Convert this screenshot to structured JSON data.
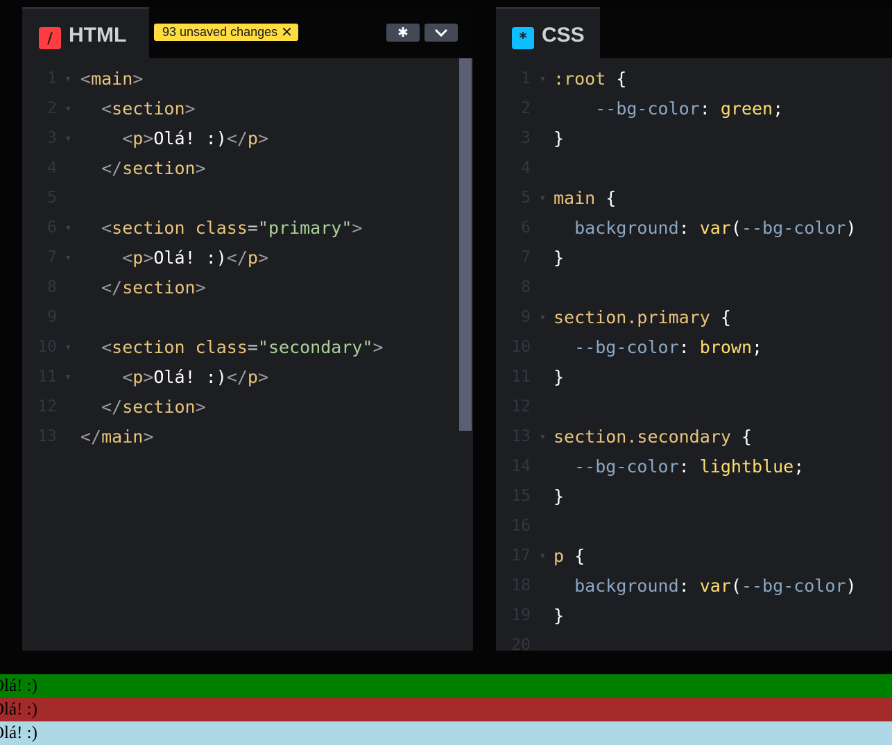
{
  "html_pane": {
    "title": "HTML",
    "icon": "html-slash-icon",
    "unsaved_badge": "93 unsaved changes",
    "unsaved_close": "✕",
    "settings_icon": "gear-icon",
    "collapse_icon": "chevron-down-icon",
    "lines": [
      {
        "n": "1",
        "fold": true,
        "tokens": [
          [
            "tag",
            "<"
          ],
          [
            "name",
            "main"
          ],
          [
            "tag",
            ">"
          ]
        ]
      },
      {
        "n": "2",
        "fold": true,
        "tokens": [
          [
            "text",
            "  "
          ],
          [
            "tag",
            "<"
          ],
          [
            "name",
            "section"
          ],
          [
            "tag",
            ">"
          ]
        ]
      },
      {
        "n": "3",
        "fold": true,
        "tokens": [
          [
            "text",
            "    "
          ],
          [
            "tag",
            "<"
          ],
          [
            "name",
            "p"
          ],
          [
            "tag",
            ">"
          ],
          [
            "text",
            "Olá! :)"
          ],
          [
            "tag",
            "</"
          ],
          [
            "name",
            "p"
          ],
          [
            "tag",
            ">"
          ]
        ]
      },
      {
        "n": "4",
        "fold": false,
        "tokens": [
          [
            "text",
            "  "
          ],
          [
            "tag",
            "</"
          ],
          [
            "name",
            "section"
          ],
          [
            "tag",
            ">"
          ]
        ]
      },
      {
        "n": "5",
        "fold": false,
        "tokens": []
      },
      {
        "n": "6",
        "fold": true,
        "tokens": [
          [
            "text",
            "  "
          ],
          [
            "tag",
            "<"
          ],
          [
            "name",
            "section"
          ],
          [
            "text",
            " "
          ],
          [
            "attr",
            "class"
          ],
          [
            "eq",
            "="
          ],
          [
            "str",
            "\"primary\""
          ],
          [
            "tag",
            ">"
          ]
        ]
      },
      {
        "n": "7",
        "fold": true,
        "tokens": [
          [
            "text",
            "    "
          ],
          [
            "tag",
            "<"
          ],
          [
            "name",
            "p"
          ],
          [
            "tag",
            ">"
          ],
          [
            "text",
            "Olá! :)"
          ],
          [
            "tag",
            "</"
          ],
          [
            "name",
            "p"
          ],
          [
            "tag",
            ">"
          ]
        ]
      },
      {
        "n": "8",
        "fold": false,
        "tokens": [
          [
            "text",
            "  "
          ],
          [
            "tag",
            "</"
          ],
          [
            "name",
            "section"
          ],
          [
            "tag",
            ">"
          ]
        ]
      },
      {
        "n": "9",
        "fold": false,
        "tokens": []
      },
      {
        "n": "10",
        "fold": true,
        "tokens": [
          [
            "text",
            "  "
          ],
          [
            "tag",
            "<"
          ],
          [
            "name",
            "section"
          ],
          [
            "text",
            " "
          ],
          [
            "attr",
            "class"
          ],
          [
            "eq",
            "="
          ],
          [
            "str",
            "\"secondary\""
          ],
          [
            "tag",
            ">"
          ]
        ]
      },
      {
        "n": "11",
        "fold": true,
        "tokens": [
          [
            "text",
            "    "
          ],
          [
            "tag",
            "<"
          ],
          [
            "name",
            "p"
          ],
          [
            "tag",
            ">"
          ],
          [
            "text",
            "Olá! :)"
          ],
          [
            "tag",
            "</"
          ],
          [
            "name",
            "p"
          ],
          [
            "tag",
            ">"
          ]
        ]
      },
      {
        "n": "12",
        "fold": false,
        "tokens": [
          [
            "text",
            "  "
          ],
          [
            "tag",
            "</"
          ],
          [
            "name",
            "section"
          ],
          [
            "tag",
            ">"
          ]
        ]
      },
      {
        "n": "13",
        "fold": false,
        "tokens": [
          [
            "tag",
            "</"
          ],
          [
            "name",
            "main"
          ],
          [
            "tag",
            ">"
          ]
        ]
      }
    ]
  },
  "css_pane": {
    "title": "CSS",
    "icon": "css-asterisk-icon",
    "lines": [
      {
        "n": "1",
        "fold": true,
        "tokens": [
          [
            "sel",
            ":root"
          ],
          [
            "punc",
            " {"
          ]
        ]
      },
      {
        "n": "2",
        "fold": false,
        "tokens": [
          [
            "punc",
            "    "
          ],
          [
            "prop",
            "--bg-color"
          ],
          [
            "punc",
            ": "
          ],
          [
            "val",
            "green"
          ],
          [
            "punc",
            ";"
          ]
        ]
      },
      {
        "n": "3",
        "fold": false,
        "tokens": [
          [
            "punc",
            "}"
          ]
        ]
      },
      {
        "n": "4",
        "fold": false,
        "tokens": []
      },
      {
        "n": "5",
        "fold": true,
        "tokens": [
          [
            "sel",
            "main"
          ],
          [
            "punc",
            " {"
          ]
        ]
      },
      {
        "n": "6",
        "fold": false,
        "tokens": [
          [
            "punc",
            "  "
          ],
          [
            "prop",
            "background"
          ],
          [
            "punc",
            ": "
          ],
          [
            "val",
            "var"
          ],
          [
            "punc",
            "("
          ],
          [
            "prop",
            "--bg-color"
          ],
          [
            "punc",
            ")"
          ]
        ]
      },
      {
        "n": "7",
        "fold": false,
        "tokens": [
          [
            "punc",
            "}"
          ]
        ]
      },
      {
        "n": "8",
        "fold": false,
        "tokens": []
      },
      {
        "n": "9",
        "fold": true,
        "tokens": [
          [
            "sel",
            "section.primary"
          ],
          [
            "punc",
            " {"
          ]
        ]
      },
      {
        "n": "10",
        "fold": false,
        "tokens": [
          [
            "punc",
            "  "
          ],
          [
            "prop",
            "--bg-color"
          ],
          [
            "punc",
            ": "
          ],
          [
            "val",
            "brown"
          ],
          [
            "punc",
            ";"
          ]
        ]
      },
      {
        "n": "11",
        "fold": false,
        "tokens": [
          [
            "punc",
            "}"
          ]
        ]
      },
      {
        "n": "12",
        "fold": false,
        "tokens": []
      },
      {
        "n": "13",
        "fold": true,
        "tokens": [
          [
            "sel",
            "section.secondary"
          ],
          [
            "punc",
            " {"
          ]
        ]
      },
      {
        "n": "14",
        "fold": false,
        "tokens": [
          [
            "punc",
            "  "
          ],
          [
            "prop",
            "--bg-color"
          ],
          [
            "punc",
            ": "
          ],
          [
            "val",
            "lightblue"
          ],
          [
            "punc",
            ";"
          ]
        ]
      },
      {
        "n": "15",
        "fold": false,
        "tokens": [
          [
            "punc",
            "}"
          ]
        ]
      },
      {
        "n": "16",
        "fold": false,
        "tokens": []
      },
      {
        "n": "17",
        "fold": true,
        "tokens": [
          [
            "sel",
            "p"
          ],
          [
            "punc",
            " {"
          ]
        ]
      },
      {
        "n": "18",
        "fold": false,
        "tokens": [
          [
            "punc",
            "  "
          ],
          [
            "prop",
            "background"
          ],
          [
            "punc",
            ": "
          ],
          [
            "val",
            "var"
          ],
          [
            "punc",
            "("
          ],
          [
            "prop",
            "--bg-color"
          ],
          [
            "punc",
            ")"
          ]
        ]
      },
      {
        "n": "19",
        "fold": false,
        "tokens": [
          [
            "punc",
            "}"
          ]
        ]
      },
      {
        "n": "20",
        "fold": false,
        "tokens": []
      }
    ]
  },
  "result": {
    "rows": [
      {
        "text": "Olá! :)",
        "color": "#008000"
      },
      {
        "text": "Olá! :)",
        "color": "#a52a2a"
      },
      {
        "text": "Olá! :)",
        "color": "#add8e6"
      }
    ]
  },
  "colors": {
    "editor_bg": "#1d1e22",
    "html_accent": "#ff3c41",
    "css_accent": "#0ebeff",
    "badge": "#ffdd40"
  }
}
